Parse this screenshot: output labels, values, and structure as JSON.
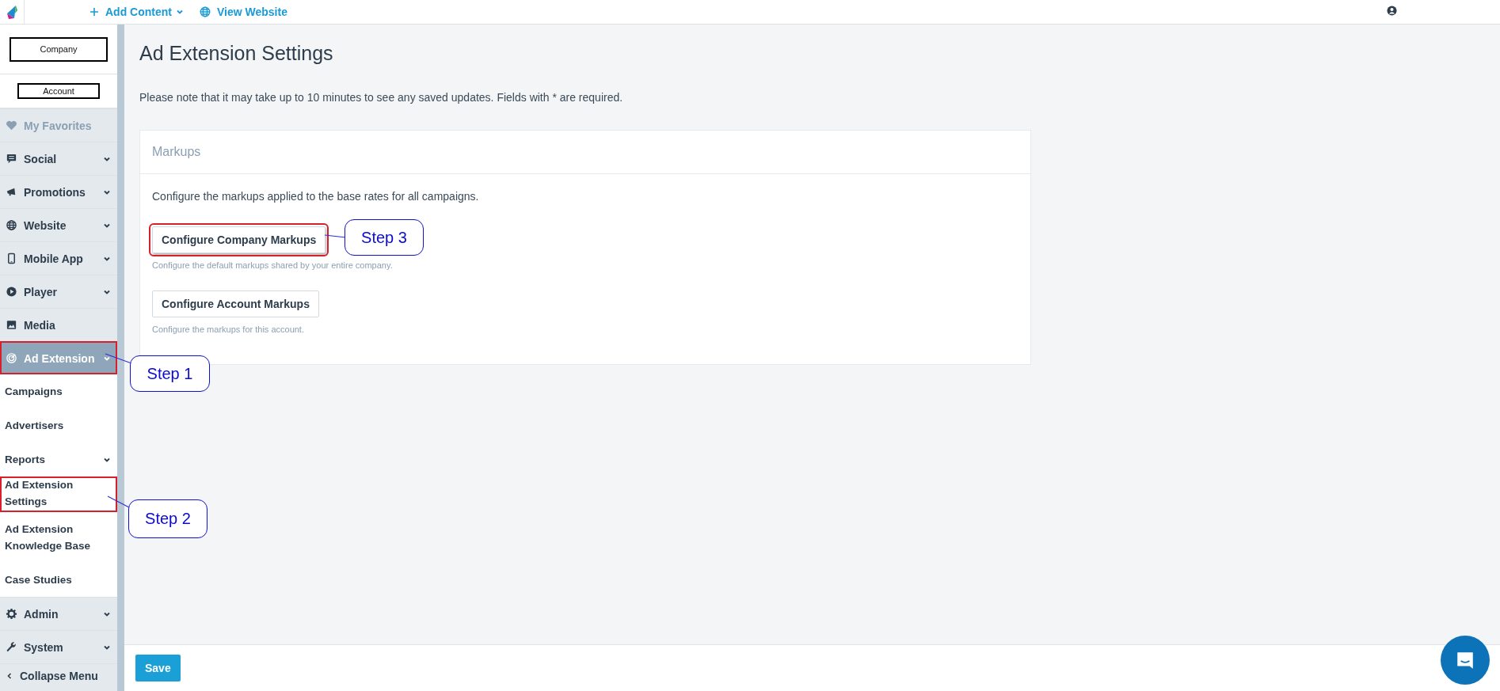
{
  "topbar": {
    "links": [
      {
        "label": "Add Content",
        "caret": true
      },
      {
        "label": "View Website",
        "caret": false
      }
    ]
  },
  "sidebar": {
    "scope_buttons": [
      "Company",
      "Account"
    ],
    "items": [
      {
        "label": "My Favorites",
        "muted": true,
        "submenu": false,
        "selected": false,
        "highlighted": false
      },
      {
        "label": "Social",
        "muted": false,
        "submenu": true,
        "selected": false,
        "highlighted": false
      },
      {
        "label": "Promotions",
        "muted": false,
        "submenu": true,
        "selected": false,
        "highlighted": false
      },
      {
        "label": "Website",
        "muted": false,
        "submenu": true,
        "selected": false,
        "highlighted": false
      },
      {
        "label": "Mobile App",
        "muted": false,
        "submenu": true,
        "selected": false,
        "highlighted": false
      },
      {
        "label": "Player",
        "muted": false,
        "submenu": true,
        "selected": false,
        "highlighted": false
      },
      {
        "label": "Media",
        "muted": false,
        "submenu": false,
        "selected": false,
        "highlighted": false
      },
      {
        "label": "Ad Extension",
        "muted": false,
        "submenu": true,
        "selected": true,
        "highlighted": true,
        "children": [
          {
            "label": "Campaigns",
            "submenu": false,
            "selected": false,
            "highlighted": false
          },
          {
            "label": "Advertisers",
            "submenu": false,
            "selected": false,
            "highlighted": false
          },
          {
            "label": "Reports",
            "submenu": true,
            "selected": false,
            "highlighted": false
          },
          {
            "label": "Ad Extension Settings",
            "submenu": false,
            "selected": true,
            "highlighted": true
          },
          {
            "label": "Ad Extension Knowledge Base",
            "submenu": false,
            "selected": false,
            "highlighted": false
          },
          {
            "label": "Case Studies",
            "submenu": false,
            "selected": false,
            "highlighted": false
          }
        ]
      },
      {
        "label": "Admin",
        "muted": false,
        "submenu": true,
        "selected": false,
        "highlighted": false
      },
      {
        "label": "System",
        "muted": false,
        "submenu": true,
        "selected": false,
        "highlighted": false
      }
    ],
    "collapse": "Collapse Menu"
  },
  "main": {
    "title": "Ad Extension Settings",
    "note": "Please note that it may take up to 10 minutes to see any saved updates. Fields with * are required.",
    "card": {
      "title": "Markups",
      "description": "Configure the markups applied to the base rates for all campaigns.",
      "actions": [
        {
          "button": "Configure Company Markups",
          "help": "Configure the default markups shared by your entire company.",
          "highlighted": true
        },
        {
          "button": "Configure Account Markups",
          "help": "Configure the markups for this account.",
          "highlighted": false
        }
      ]
    },
    "save": "Save"
  },
  "annotations": [
    "Step 1",
    "Step 2",
    "Step 3"
  ]
}
